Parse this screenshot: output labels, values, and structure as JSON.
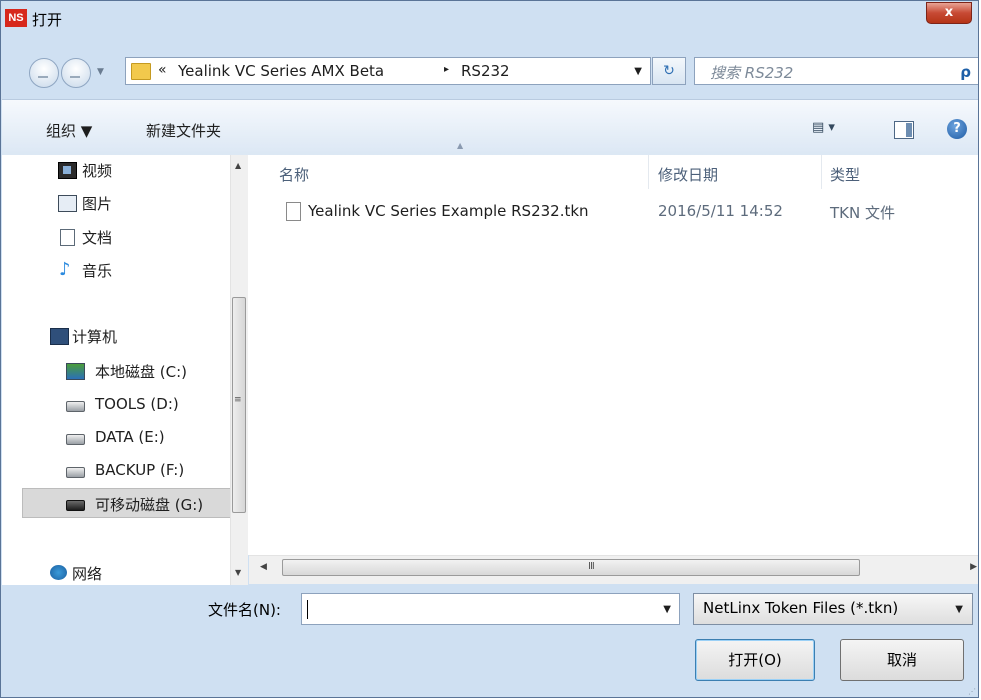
{
  "window": {
    "app_icon_text": "NS",
    "title": "打开",
    "close_label": "x"
  },
  "address": {
    "chevron": "«",
    "crumbs": [
      "Yealink VC Series AMX Beta",
      "RS232"
    ],
    "separator": "▸",
    "search_placeholder": "搜索 RS232"
  },
  "toolbar": {
    "organize": "组织 ▼",
    "new_folder": "新建文件夹",
    "view": "▤ ▾",
    "help": "?"
  },
  "sidebar": {
    "items": [
      {
        "label": "视频",
        "icon": "video-icon"
      },
      {
        "label": "图片",
        "icon": "picture-icon"
      },
      {
        "label": "文档",
        "icon": "document-icon"
      },
      {
        "label": "音乐",
        "icon": "music-icon"
      },
      {
        "label": "计算机",
        "icon": "computer-icon"
      },
      {
        "label": "本地磁盘 (C:)",
        "icon": "system-drive-icon"
      },
      {
        "label": "TOOLS (D:)",
        "icon": "drive-icon"
      },
      {
        "label": "DATA (E:)",
        "icon": "drive-icon"
      },
      {
        "label": "BACKUP (F:)",
        "icon": "drive-icon"
      },
      {
        "label": "可移动磁盘 (G:)",
        "icon": "removable-drive-icon",
        "selected": true
      },
      {
        "label": "网络",
        "icon": "network-icon"
      }
    ]
  },
  "columns": {
    "name": "名称",
    "modified": "修改日期",
    "type": "类型"
  },
  "files": [
    {
      "name": "Yealink VC Series Example RS232.tkn",
      "modified": "2016/5/11 14:52",
      "type": "TKN 文件"
    }
  ],
  "bottom": {
    "filename_label": "文件名(N):",
    "filename_value": "",
    "filter": "NetLinx Token Files (*.tkn)",
    "open_button": "打开(O)",
    "cancel_button": "取消"
  },
  "scroll": {
    "grip_h": "III",
    "grip_v": "≡"
  },
  "colors": {
    "frame": "#cfe0f2",
    "close_button": "#c74a34",
    "selected_row": "#d9d9d9",
    "app_icon": "#d7281c"
  }
}
